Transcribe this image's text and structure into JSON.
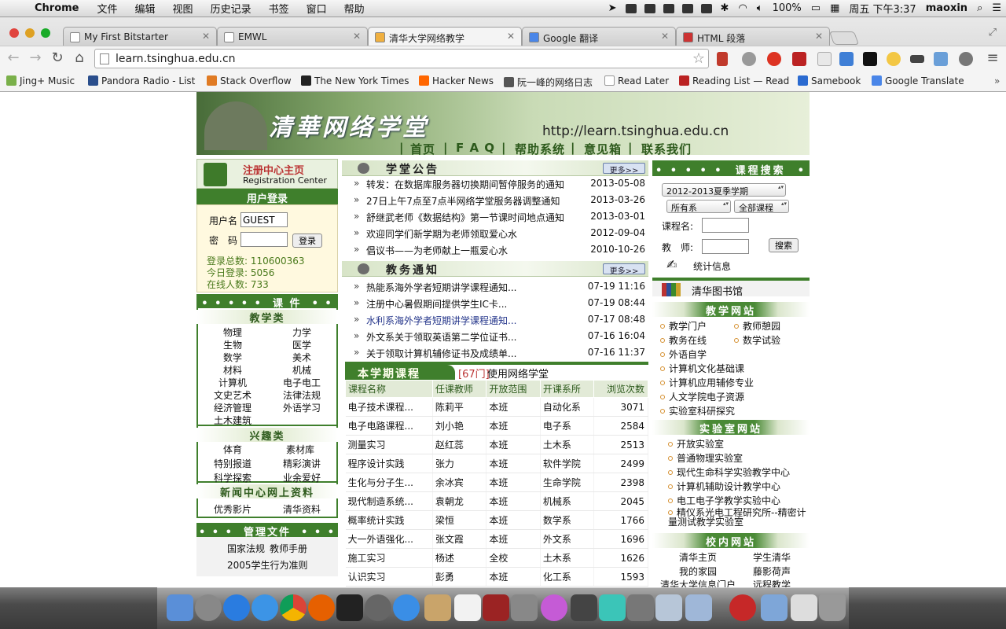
{
  "menubar": {
    "app_name": "Chrome",
    "menus": [
      "文件",
      "编辑",
      "视图",
      "历史记录",
      "书签",
      "窗口",
      "帮助"
    ],
    "battery": "100%",
    "datetime": "周五 下午3:37",
    "user": "maoxin"
  },
  "tabs": [
    {
      "title": "My First Bitstarter"
    },
    {
      "title": "EMWL"
    },
    {
      "title": "清华大学网络教学"
    },
    {
      "title": "Google 翻译"
    },
    {
      "title": "HTML 段落"
    }
  ],
  "address_bar": {
    "url": "learn.tsinghua.edu.cn"
  },
  "bookmarks": [
    "Jing+ Music",
    "Pandora Radio - List",
    "Stack Overflow",
    "The New York Times",
    "Hacker News",
    "阮一峰的网络日志",
    "Read Later",
    "Reading List — Read",
    "Samebook",
    "Google Translate"
  ],
  "site": {
    "banner_title": "清華网络学堂",
    "banner_url": "http://learn.tsinghua.edu.cn",
    "nav": [
      "首页",
      "F A Q",
      "帮助系统",
      "意见箱",
      "联系我们"
    ],
    "registration": {
      "title": "注册中心主页",
      "subtitle": "Registration Center"
    },
    "login": {
      "header": "用户登录",
      "username_label": "用户名",
      "username_value": "GUEST",
      "password_label": "密　码",
      "login_button": "登录",
      "total_logins": "登录总数: 110600363",
      "today_logins": "今日登录: 5056",
      "online_users": "在线人数: 733"
    },
    "courseware": {
      "header": "课 件",
      "teaching_header": "教学类",
      "teaching_items": [
        "物理",
        "力学",
        "生物",
        "医学",
        "数学",
        "美术",
        "材料",
        "机械",
        "计算机",
        "电子电工",
        "文史艺术",
        "法律法规",
        "经济管理",
        "外语学习",
        "土木建筑"
      ],
      "interest_header": "兴趣类",
      "interest_items": [
        "体育",
        "素材库",
        "特别报道",
        "精彩演讲",
        "科学探索",
        "业余爱好"
      ],
      "news_header": "新闻中心网上资料",
      "news_items": [
        "优秀影片",
        "清华资料"
      ]
    },
    "admin_docs": {
      "header": "管理文件",
      "items": [
        "国家法规",
        "教师手册",
        "2005学生行为准则"
      ]
    },
    "announcements": {
      "header": "学堂公告",
      "more": "更多>>",
      "items": [
        {
          "title": "转发：在数据库服务器切换期间暂停服务的通知",
          "date": "2013-05-08"
        },
        {
          "title": "27日上午7点至7点半网络学堂服务器调整通知",
          "date": "2013-03-26"
        },
        {
          "title": "舒继武老师《数据结构》第一节课时间地点通知",
          "date": "2013-03-01"
        },
        {
          "title": "欢迎同学们新学期为老师领取爱心水",
          "date": "2012-09-04"
        },
        {
          "title": "倡议书——为老师献上一瓶爱心水",
          "date": "2010-10-26"
        }
      ]
    },
    "academic_notices": {
      "header": "教务通知",
      "more": "更多>>",
      "items": [
        {
          "title": "热能系海外学者短期讲学课程通知...",
          "date": "07-19 11:16"
        },
        {
          "title": "注册中心暑假期间提供学生IC卡...",
          "date": "07-19 08:44"
        },
        {
          "title": "水利系海外学者短期讲学课程通知...",
          "date": "07-17 08:48"
        },
        {
          "title": "外文系关于领取英语第二学位证书...",
          "date": "07-16 16:04"
        },
        {
          "title": "关于领取计算机辅修证书及成绩单...",
          "date": "07-16 11:37"
        }
      ]
    },
    "courses": {
      "header": "本学期课程",
      "count": "[67门]",
      "suffix": "使用网络学堂",
      "columns": [
        "课程名称",
        "任课教师",
        "开放范围",
        "开课系所",
        "浏览次数"
      ],
      "rows": [
        [
          "电子技术课程...",
          "陈莉平",
          "本班",
          "自动化系",
          "3071"
        ],
        [
          "电子电路课程...",
          "刘小艳",
          "本班",
          "电子系",
          "2584"
        ],
        [
          "测量实习",
          "赵红蕊",
          "本班",
          "土木系",
          "2513"
        ],
        [
          "程序设计实践",
          "张力",
          "本班",
          "软件学院",
          "2499"
        ],
        [
          "生化与分子生...",
          "余冰宾",
          "本班",
          "生命学院",
          "2398"
        ],
        [
          "现代制造系统...",
          "袁朝龙",
          "本班",
          "机械系",
          "2045"
        ],
        [
          "概率统计实践",
          "梁恒",
          "本班",
          "数学系",
          "1766"
        ],
        [
          "大一外语强化...",
          "张文霞",
          "本班",
          "外文系",
          "1696"
        ],
        [
          "施工实习",
          "杨述",
          "全校",
          "土木系",
          "1626"
        ],
        [
          "认识实习",
          "彭勇",
          "本班",
          "化工系",
          "1593"
        ]
      ]
    },
    "course_search": {
      "header": "课程搜索",
      "semester": "2012-2013夏季学期",
      "department": "所有系",
      "course_type": "全部课程",
      "course_name_label": "课程名:",
      "teacher_label": "教　师:",
      "search_button": "搜索",
      "stats_label": "统计信息"
    },
    "library": {
      "label": "清华图书馆"
    },
    "teaching_sites": {
      "header": "教学网站",
      "items": [
        "教学门户",
        "教师憩园",
        "教务在线",
        "数学试验",
        "外语自学",
        "计算机文化基础课",
        "计算机应用辅修专业",
        "人文学院电子资源",
        "实验室科研探究"
      ]
    },
    "lab_sites": {
      "header": "实验室网站",
      "items": [
        "开放实验室",
        "普通物理实验室",
        "现代生命科学实验教学中心",
        "计算机辅助设计教学中心",
        "电工电子学教学实验中心",
        "精仪系光电工程研究所--精密计量测试教学实验室"
      ]
    },
    "campus_sites": {
      "header": "校内网站",
      "items": [
        "清华主页",
        "学生清华",
        "我的家园",
        "藤影荷声",
        "清华大学信息门户",
        "远程教学"
      ]
    }
  }
}
